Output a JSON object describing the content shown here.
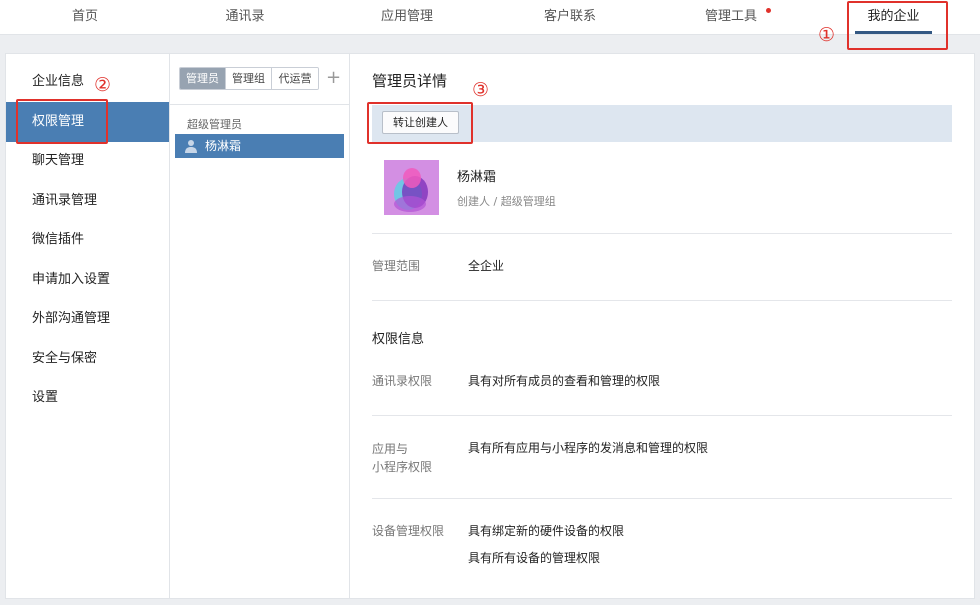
{
  "topnav": {
    "items": [
      "首页",
      "通讯录",
      "应用管理",
      "客户联系",
      "管理工具",
      "我的企业"
    ],
    "active": "我的企业",
    "notification_on": "管理工具"
  },
  "annotations": [
    "①",
    "②",
    "③"
  ],
  "leftmenu": {
    "items": [
      "企业信息",
      "权限管理",
      "聊天管理",
      "通讯录管理",
      "微信插件",
      "申请加入设置",
      "外部沟通管理",
      "安全与保密",
      "设置"
    ],
    "active": "权限管理"
  },
  "midcol": {
    "tabs": [
      "管理员",
      "管理组",
      "代运营"
    ],
    "active_tab": "管理员",
    "add_label": "+",
    "group_label": "超级管理员",
    "members": [
      "杨淋霜"
    ]
  },
  "detail": {
    "title": "管理员详情",
    "transfer_button": "转让创建人",
    "user_name": "杨淋霜",
    "user_role": "创建人 / 超级管理组",
    "scope_label": "管理范围",
    "scope_value": "全企业",
    "permissions_title": "权限信息",
    "permissions": [
      {
        "label_lines": [
          "通讯录权限"
        ],
        "values": [
          "具有对所有成员的查看和管理的权限"
        ]
      },
      {
        "label_lines": [
          "应用与",
          "小程序权限"
        ],
        "values": [
          "具有所有应用与小程序的发消息和管理的权限"
        ]
      },
      {
        "label_lines": [
          "设备管理权限"
        ],
        "values": [
          "具有绑定新的硬件设备的权限",
          "具有所有设备的管理权限"
        ]
      }
    ]
  },
  "colors": {
    "accent": "#4a7eb3",
    "nav_underline": "#335883",
    "annotation_red": "#e0312b",
    "toolbar_bg": "#dde6f0"
  }
}
